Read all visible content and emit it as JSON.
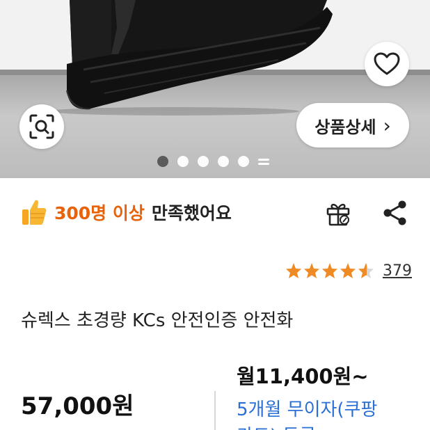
{
  "image_carousel": {
    "total_dots": 5,
    "active_index": 0
  },
  "buttons": {
    "wishlist_icon": "heart-icon",
    "image_search_icon": "image-search-icon",
    "detail_label": "상품상세",
    "detail_chevron": "›"
  },
  "satisfaction": {
    "highlight": "300명 이상",
    "suffix": "만족했어요",
    "icon": "thumbs-up-icon"
  },
  "actions": {
    "gift_icon": "gift-icon",
    "share_icon": "share-icon"
  },
  "rating": {
    "stars": 4.5,
    "review_count": "379"
  },
  "product": {
    "title": "슈렉스 초경량 KCs 안전인증 안전화",
    "price": "57,000원",
    "monthly_price": "월11,400원~",
    "installment_text": "5개월 무이자(쿠팡",
    "installment_text_cont": "카드) 등록"
  },
  "colors": {
    "accent_orange": "#e8620b",
    "star": "#f08a24",
    "link_blue": "#2a6fd6"
  }
}
